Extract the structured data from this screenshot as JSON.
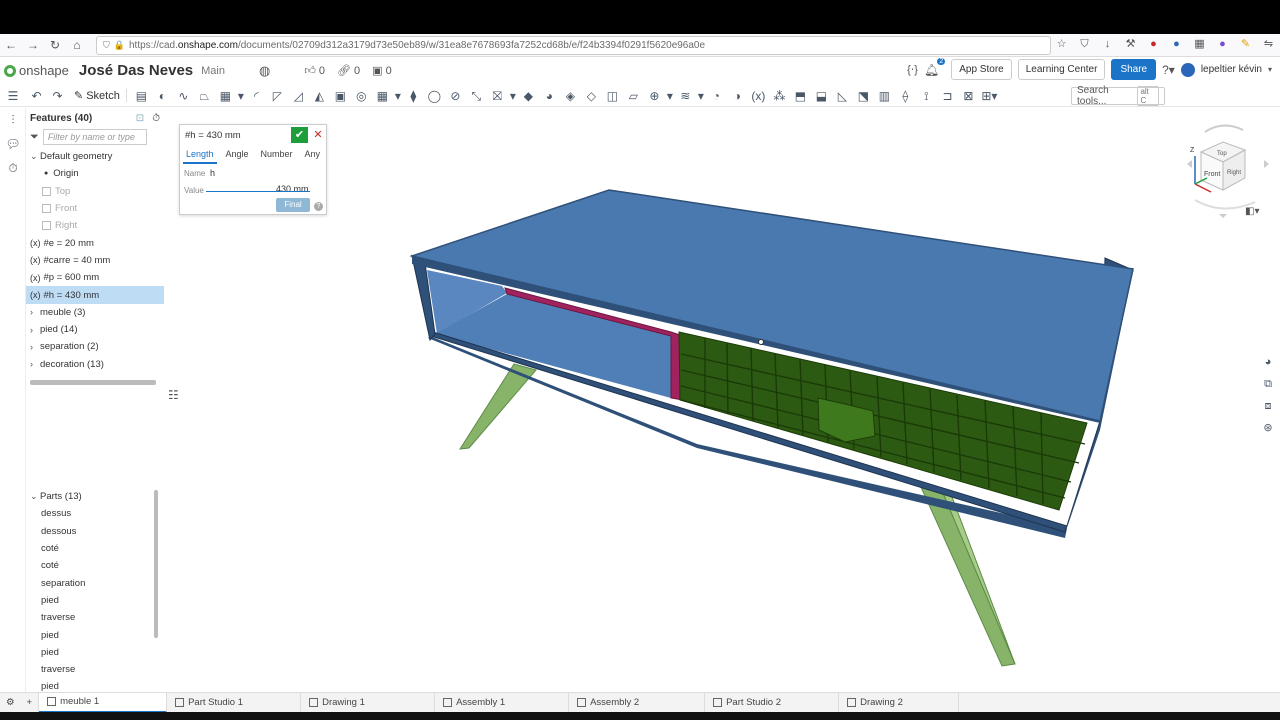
{
  "browser": {
    "url_prefix": "https://cad.",
    "url_domain": "onshape.com",
    "url_rest": "/documents/02709d312a3179d73e50eb89/w/31ea8e7678693fa7252cd68b/e/f24b3394f0291f5620e96a0e"
  },
  "doc": {
    "logo": "onshape",
    "title": "José Das Neves",
    "branch": "Main",
    "likes": "0",
    "links": "0",
    "versions": "0",
    "notif_count": "2",
    "app_store": "App Store",
    "learning": "Learning Center",
    "share": "Share",
    "user": "lepeltier kévin"
  },
  "toolbar": {
    "sketch": "Sketch",
    "search": "Search tools...",
    "search_kbd": "alt C"
  },
  "features": {
    "header": "Features (40)",
    "filter_placeholder": "Filter by name or type",
    "default_geometry": "Default geometry",
    "origin": "Origin",
    "planes": [
      "Top",
      "Front",
      "Right"
    ],
    "variables": [
      "#e = 20 mm",
      "#carre = 40 mm",
      "#p = 600 mm",
      "#h = 430 mm"
    ],
    "variable_prefix": "(x)",
    "folders": [
      "meuble (3)",
      "pied (14)",
      "separation (2)",
      "decoration (13)"
    ]
  },
  "parts": {
    "header": "Parts (13)",
    "items": [
      "dessus",
      "dessous",
      "coté",
      "coté",
      "separation",
      "pied",
      "traverse",
      "pied",
      "pied",
      "traverse",
      "pied"
    ]
  },
  "dialog": {
    "title": "#h = 430 mm",
    "tabs": [
      "Length",
      "Angle",
      "Number",
      "Any"
    ],
    "name_label": "Name",
    "name_value": "h",
    "value_label": "Value",
    "value_value": "430 mm",
    "final": "Final"
  },
  "viewcube": {
    "top": "Top",
    "front": "Front",
    "right": "Right",
    "z": "Z"
  },
  "tabs": [
    "meuble 1",
    "Part Studio 1",
    "Drawing 1",
    "Assembly 1",
    "Assembly 2",
    "Part Studio 2",
    "Drawing 2"
  ],
  "colors": {
    "accent": "#1b74c8",
    "top_surface": "#4a79b0",
    "frame": "#2f5078",
    "drawer_front": "#2d5a12",
    "separator": "#a0225e",
    "legs": "#88b46a"
  }
}
